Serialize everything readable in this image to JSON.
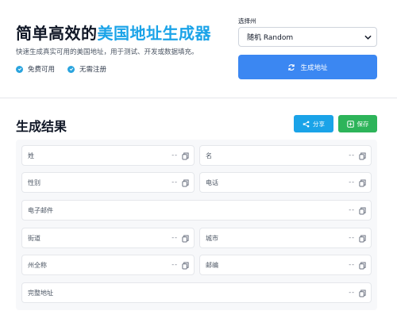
{
  "header": {
    "title_part1": "简单高效的",
    "title_part2": "美国地址生成器",
    "subtitle": "快速生成真实可用的美国地址，用于测试、开发或数据填充。",
    "features": [
      "免费可用",
      "无需注册"
    ]
  },
  "state_selector": {
    "label": "选择州",
    "selected": "随机 Random"
  },
  "generate_button": {
    "label": "生成地址"
  },
  "results": {
    "title": "生成结果",
    "share_label": "分享",
    "save_label": "保存",
    "empty_value": "--",
    "fields": {
      "last_name": "姓",
      "first_name": "名",
      "gender": "性别",
      "phone": "电话",
      "email": "电子邮件",
      "street": "街道",
      "city": "城市",
      "state_full": "州全称",
      "zip": "邮编",
      "full_address": "完整地址"
    }
  },
  "colors": {
    "accent": "#1aa3e8",
    "primary_button": "#3b87f2",
    "save_button": "#2db45a"
  }
}
